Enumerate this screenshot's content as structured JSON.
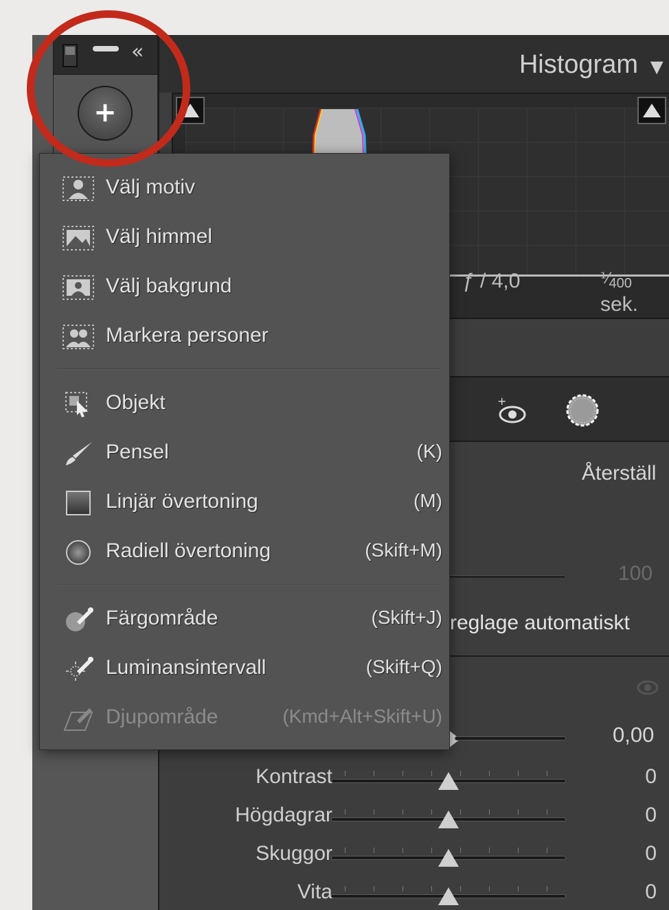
{
  "histogram": {
    "title": "Histogram",
    "aperture": "ƒ / 4,0",
    "shutter_fraction": "⅟",
    "shutter_denominator": "400",
    "shutter_unit": " sek."
  },
  "mask_toolbar": {
    "add_button": "+",
    "collapse_icon": "«"
  },
  "menu": {
    "items": [
      {
        "label": "Välj motiv",
        "shortcut": "",
        "icon": "person-select-icon"
      },
      {
        "label": "Välj himmel",
        "shortcut": "",
        "icon": "sky-select-icon"
      },
      {
        "label": "Välj bakgrund",
        "shortcut": "",
        "icon": "background-select-icon"
      },
      {
        "label": "Markera personer",
        "shortcut": "",
        "icon": "people-select-icon"
      },
      {
        "label": "Objekt",
        "shortcut": "",
        "icon": "object-select-icon"
      },
      {
        "label": "Pensel",
        "shortcut": "(K)",
        "icon": "brush-icon"
      },
      {
        "label": "Linjär övertoning",
        "shortcut": "(M)",
        "icon": "linear-gradient-icon"
      },
      {
        "label": "Radiell övertoning",
        "shortcut": "(Skift+M)",
        "icon": "radial-gradient-icon"
      },
      {
        "label": "Färgområde",
        "shortcut": "(Skift+J)",
        "icon": "color-range-icon"
      },
      {
        "label": "Luminansintervall",
        "shortcut": "(Skift+Q)",
        "icon": "luminance-range-icon"
      },
      {
        "label": "Djupområde",
        "shortcut": "(Kmd+Alt+Skift+U)",
        "icon": "depth-range-icon",
        "disabled": true
      }
    ]
  },
  "panel": {
    "reset_label": "Återställ",
    "amount_value": "100",
    "auto_label": "reglage automatiskt",
    "exposure_value": "0,00",
    "adjustments": [
      {
        "label": "Kontrast",
        "value": "0"
      },
      {
        "label": "Högdagrar",
        "value": "0"
      },
      {
        "label": "Skuggor",
        "value": "0"
      },
      {
        "label": "Vita",
        "value": "0"
      }
    ]
  },
  "colors": {
    "annotation": "#c22a1c",
    "menu_bg": "#535353",
    "panel_bg": "#3d3d3d"
  }
}
